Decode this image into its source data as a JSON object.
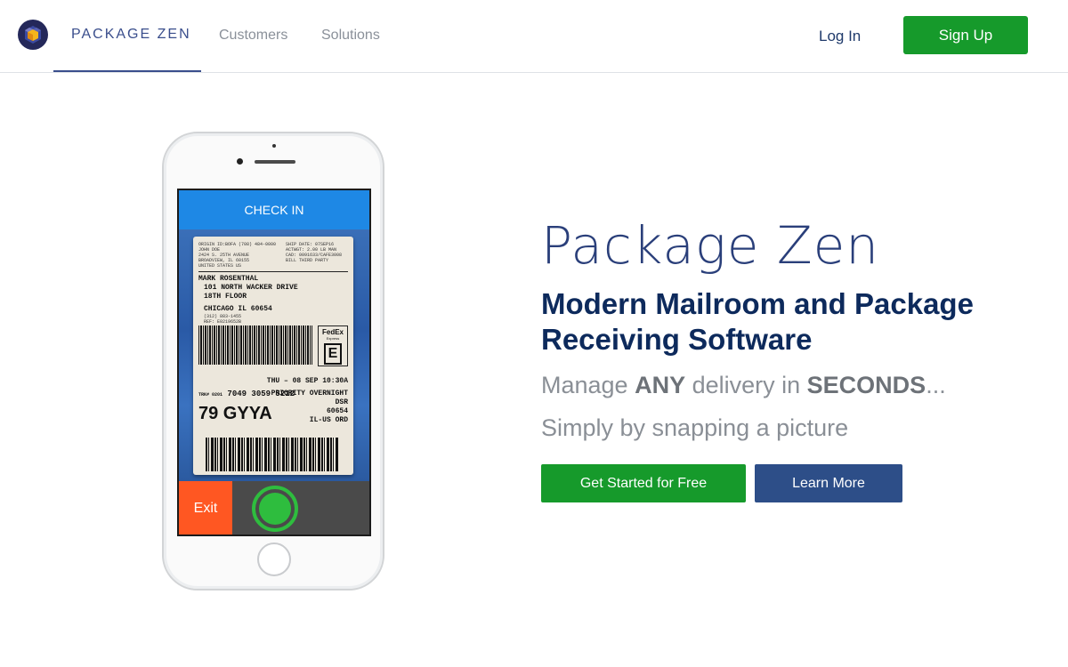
{
  "header": {
    "brand": "PACKAGE ZEN",
    "nav": [
      "Customers",
      "Solutions"
    ],
    "login_label": "Log In",
    "signup_label": "Sign Up",
    "logo_icon": "package-zen-logo-icon"
  },
  "phone": {
    "checkin_label": "CHECK IN",
    "exit_label": "Exit",
    "label": {
      "origin": "ORIGIN ID:BOFA (708) 484-0000\nJOHN DOE\n2424 S. 25TH AVENUE\nBROADVIEW, IL 60155\nUNITED STATES US",
      "ship_info": "SHIP DATE: 07SEP16\nACTWGT: 2.00 LB MAN\nCAD: 0091633/CAFE3008\nBILL THIRD PARTY",
      "to_name": "MARK ROSENTHAL",
      "to_street": "101 NORTH WACKER DRIVE",
      "to_floor": "18TH FLOOR",
      "to_city": "CHICAGO IL 60654",
      "ref": "(312) 883-1455\nREF: E0219652B",
      "carrier": "FedEx",
      "carrier_sub": "Express",
      "service_letter": "E",
      "delivery_date": "THU – 08 SEP 10:30A",
      "service": "PRIORITY OVERNIGHT",
      "trk_prefix": "TRK# 0201",
      "tracking": "7049 3059 5212",
      "dsr": "DSR",
      "zip": "60654",
      "dest": "IL-US ORD",
      "route_code": "79 GYYA"
    }
  },
  "hero": {
    "title": "Package Zen",
    "subtitle": "Modern Mailroom and Package Receiving Software",
    "line1_a": "Manage ",
    "line1_b": "ANY",
    "line1_c": " delivery in ",
    "line1_d": "SECONDS",
    "line1_e": "...",
    "line2": "Simply by snapping a picture",
    "cta_primary": "Get Started for Free",
    "cta_secondary": "Learn More"
  },
  "colors": {
    "brand_navy": "#2a3f7a",
    "cta_green": "#169a2b",
    "learn_blue": "#2d4e88",
    "exit_orange": "#ff5722",
    "checkin_blue": "#1e88e5"
  }
}
